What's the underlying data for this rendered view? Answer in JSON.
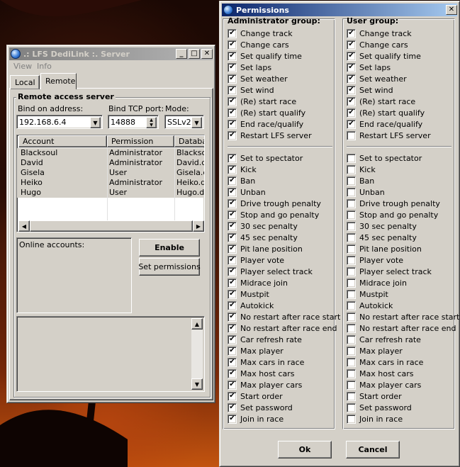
{
  "server_window": {
    "title": ".: LFS DediLink :. Server",
    "controls": {
      "minimize": "_",
      "maximize": "□",
      "close": "✕"
    },
    "menu": [
      "View",
      "Info"
    ],
    "tabs": [
      "Local",
      "Remote"
    ],
    "active_tab": "Remote",
    "group_title": "Remote access server",
    "bind_address_label": "Bind on address:",
    "bind_address_value": "192.168.6.4",
    "bind_port_label": "Bind TCP port:",
    "bind_port_value": "14888",
    "mode_label": "Mode:",
    "mode_value": "SSLv2",
    "accounts_table": {
      "headers": [
        "Account",
        "Permission",
        "Database"
      ],
      "rows": [
        [
          "Blacksoul",
          "Administrator",
          "Blacksoul.db"
        ],
        [
          "David",
          "Administrator",
          "David.db"
        ],
        [
          "Gisela",
          "User",
          "Gisela.db"
        ],
        [
          "Heiko",
          "Administrator",
          "Heiko.db"
        ],
        [
          "Hugo",
          "User",
          "Hugo.db"
        ]
      ]
    },
    "online_accounts_label": "Online accounts:",
    "enable_button": "Enable",
    "set_permissions_button": "Set permissions"
  },
  "permissions_window": {
    "title": "Permissions",
    "close": "✕",
    "admin_group_title": "Administrator group:",
    "user_group_title": "User group:",
    "section1": [
      "Change track",
      "Change cars",
      "Set qualify time",
      "Set laps",
      "Set weather",
      "Set wind",
      "(Re) start race",
      "(Re) start qualify",
      "End race/qualify",
      "Restart LFS server"
    ],
    "section2": [
      "Set to spectator",
      "Kick",
      "Ban",
      "Unban",
      "Drive trough penalty",
      "Stop and go penalty",
      "30 sec penalty",
      "45 sec penalty",
      "Pit lane position",
      "Player vote",
      "Player select track",
      "Midrace join",
      "Mustpit",
      "Autokick",
      "No restart after race start",
      "No restart after race end",
      "Car refresh rate",
      "Max player",
      "Max cars in race",
      "Max host cars",
      "Max player cars",
      "Start order",
      "Set password",
      "Join in race"
    ],
    "admin_section1_checked": [
      true,
      true,
      true,
      true,
      true,
      true,
      true,
      true,
      true,
      true
    ],
    "admin_section2_checked": [
      true,
      true,
      true,
      true,
      true,
      true,
      true,
      true,
      true,
      true,
      true,
      true,
      true,
      true,
      true,
      true,
      true,
      true,
      true,
      true,
      true,
      true,
      true,
      true
    ],
    "user_section1_checked": [
      true,
      true,
      true,
      true,
      true,
      true,
      true,
      true,
      true,
      false
    ],
    "user_section2_checked": [
      false,
      false,
      false,
      false,
      false,
      false,
      false,
      false,
      false,
      false,
      false,
      false,
      false,
      false,
      false,
      false,
      false,
      false,
      false,
      false,
      false,
      false,
      false,
      false
    ],
    "ok_button": "Ok",
    "cancel_button": "Cancel"
  },
  "icons": {
    "check": "✔",
    "dropdown": "down-arrow-icon",
    "spin": "spin-arrows-icon"
  },
  "colors": {
    "window_face": "#d4d0c8",
    "active_title_start": "#0a246a",
    "active_title_end": "#a6caf0",
    "inactive_title_start": "#808080"
  }
}
